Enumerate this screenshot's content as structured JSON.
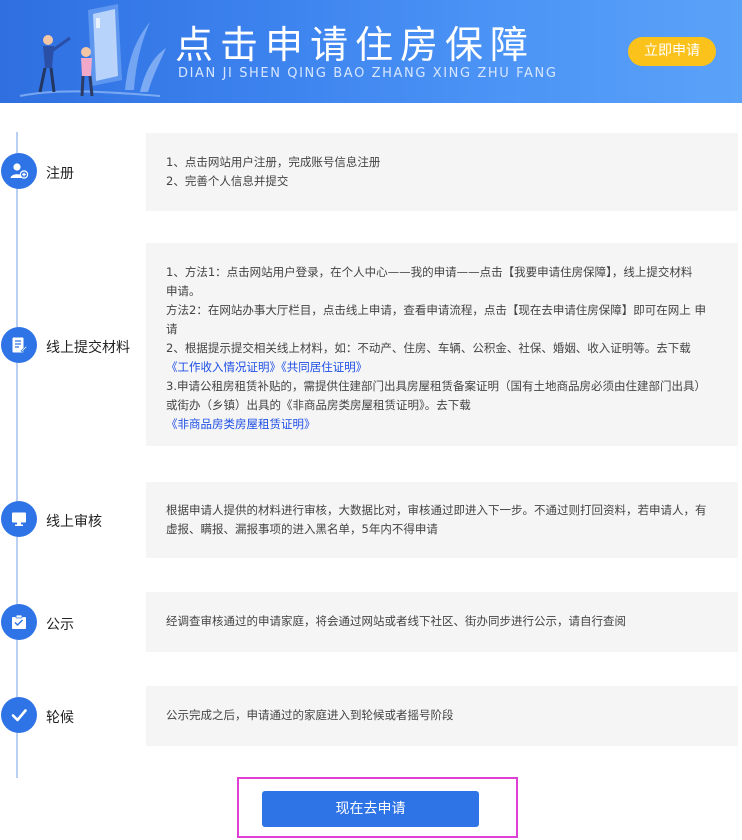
{
  "banner": {
    "title": "点击申请住房保障",
    "pinyin": "DIAN JI SHEN QING BAO ZHANG XING ZHU FANG",
    "apply_button": "立即申请",
    "art_icon": "people-with-door-illustration"
  },
  "steps": [
    {
      "label": "注册",
      "icon": "user-add-icon",
      "lines": [
        "1、点击网站用户注册，完成账号信息注册",
        "2、完善个人信息并提交"
      ]
    },
    {
      "label": "线上提交材料",
      "icon": "document-edit-icon",
      "lines": [
        "1、方法1：点击网站用户登录，在个人中心——我的申请——点击【我要申请住房保障】，线上提交材料",
        "申请。",
        "方法2：在网站办事大厅栏目，点击线上申请，查看申请流程，点击【现在去申请住房保障】即可在网上 申",
        "请",
        "2、根据提示提交相关线上材料，如：不动产、住房、车辆、公积金、社保、婚姻、收入证明等。去下载"
      ],
      "links_1": [
        "《工作收入情况证明》",
        "《共同居住证明》"
      ],
      "lines_2": [
        "3.申请公租房租赁补贴的，需提供住建部门出具房屋租赁备案证明（国有土地商品房必须由住建部门出具）",
        "或街办（乡镇）出具的《非商品房类房屋租赁证明》。去下载"
      ],
      "links_2": [
        "《非商品房类房屋租赁证明》"
      ]
    },
    {
      "label": "线上审核",
      "icon": "monitor-icon",
      "lines": [
        "根据申请人提供的材料进行审核，大数据比对，审核通过即进入下一步。不通过则打回资料，若申请人，有",
        "虚报、瞒报、漏报事项的进入黑名单，5年内不得申请"
      ]
    },
    {
      "label": "公示",
      "icon": "clipboard-icon",
      "lines": [
        "经调查审核通过的申请家庭，将会通过网站或者线下社区、街办同步进行公示，请自行查阅"
      ]
    },
    {
      "label": "轮候",
      "icon": "checkmark-icon",
      "lines": [
        "公示完成之后，申请通过的家庭进入到轮候或者摇号阶段"
      ]
    }
  ],
  "footer": {
    "apply_button": "现在去申请"
  },
  "colors": {
    "primary": "#2f74e7",
    "accent_yellow": "#fbc21c",
    "link": "#1d4ee6",
    "box_bg": "#f5f5f5",
    "highlight": "#e03fd6"
  }
}
